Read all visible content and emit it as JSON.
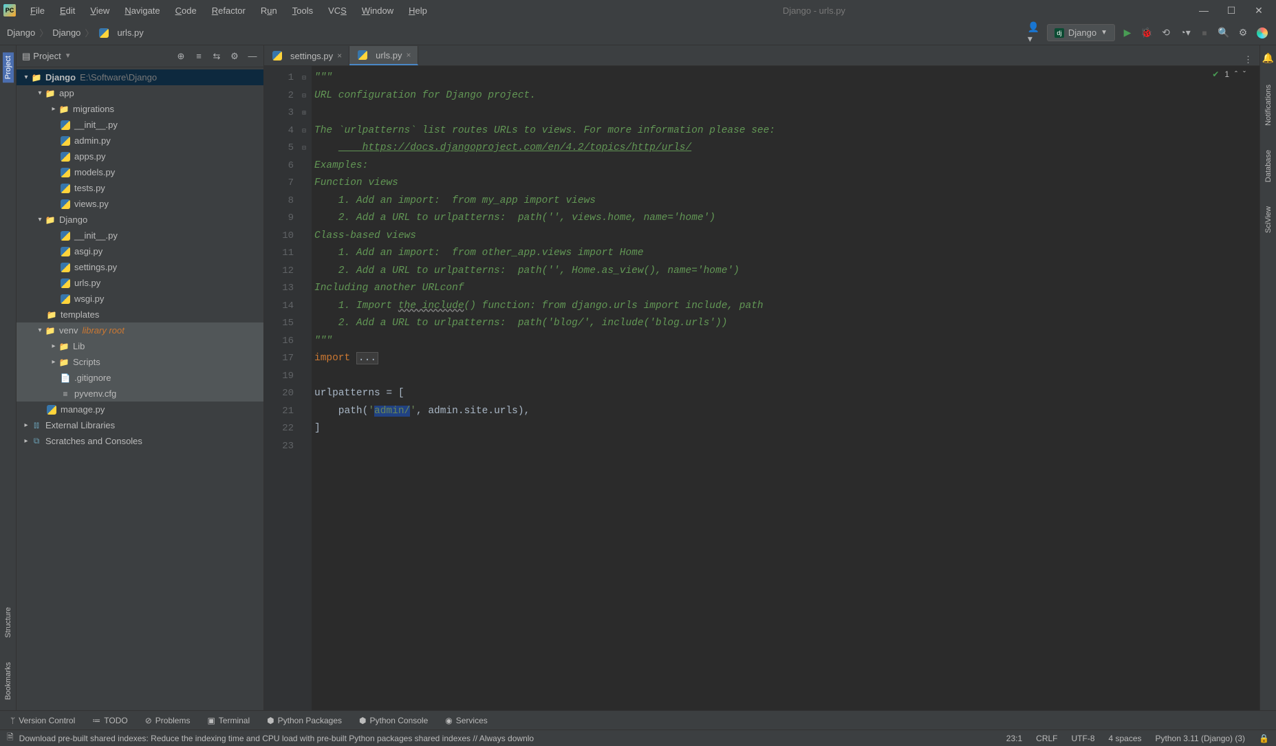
{
  "window": {
    "title": "Django - urls.py"
  },
  "menu": [
    "File",
    "Edit",
    "View",
    "Navigate",
    "Code",
    "Refactor",
    "Run",
    "Tools",
    "VCS",
    "Window",
    "Help"
  ],
  "breadcrumb": [
    "Django",
    "Django",
    "urls.py"
  ],
  "run_config": "Django",
  "project_header": "Project",
  "tree": {
    "root": {
      "name": "Django",
      "path": "E:\\Software\\Django"
    },
    "app": "app",
    "app_children": [
      "migrations",
      "__init__.py",
      "admin.py",
      "apps.py",
      "models.py",
      "tests.py",
      "views.py"
    ],
    "django_folder": "Django",
    "django_children": [
      "__init__.py",
      "asgi.py",
      "settings.py",
      "urls.py",
      "wsgi.py"
    ],
    "templates": "templates",
    "venv": "venv",
    "venv_note": "library root",
    "venv_children": [
      "Lib",
      "Scripts",
      ".gitignore",
      "pyvenv.cfg"
    ],
    "manage": "manage.py",
    "external": "External Libraries",
    "scratches": "Scratches and Consoles"
  },
  "tabs": [
    {
      "name": "settings.py",
      "active": false
    },
    {
      "name": "urls.py",
      "active": true
    }
  ],
  "inspection_count": "1",
  "code_lines": {
    "l1": "\"\"\"",
    "l2": "URL configuration for Django project.",
    "l3": "",
    "l4": "The `urlpatterns` list routes URLs to views. For more information please see:",
    "l5": "    https://docs.djangoproject.com/en/4.2/topics/http/urls/",
    "l6": "Examples:",
    "l7": "Function views",
    "l8": "    1. Add an import:  from my_app import views",
    "l9": "    2. Add a URL to urlpatterns:  path('', views.home, name='home')",
    "l10": "Class-based views",
    "l11": "    1. Add an import:  from other_app.views import Home",
    "l12": "    2. Add a URL to urlpatterns:  path('', Home.as_view(), name='home')",
    "l13": "Including another URLconf",
    "l14a": "    1. Import ",
    "l14b": "the include",
    "l14c": "() function: from django.urls import include, path",
    "l15": "    2. Add a URL to urlpatterns:  path('blog/', include('blog.urls'))",
    "l16": "\"\"\"",
    "l17a": "import ",
    "l17b": "...",
    "l19": "",
    "l20": "urlpatterns = [",
    "l21a": "    path(",
    "l21b": "'",
    "l21c": "admin/",
    "l21d": "'",
    "l21e": ", admin.site.urls),",
    "l22": "]",
    "l23": ""
  },
  "line_numbers": [
    "1",
    "2",
    "3",
    "4",
    "5",
    "6",
    "7",
    "8",
    "9",
    "10",
    "11",
    "12",
    "13",
    "14",
    "15",
    "16",
    "17",
    "19",
    "20",
    "21",
    "22",
    "23"
  ],
  "bottom_tools": [
    "Version Control",
    "TODO",
    "Problems",
    "Terminal",
    "Python Packages",
    "Python Console",
    "Services"
  ],
  "status": {
    "message": "Download pre-built shared indexes: Reduce the indexing time and CPU load with pre-built Python packages shared indexes // Always downlo",
    "cursor": "23:1",
    "line_sep": "CRLF",
    "encoding": "UTF-8",
    "indent": "4 spaces",
    "interpreter": "Python 3.11 (Django) (3)"
  },
  "right_tools": [
    "Notifications",
    "Database",
    "SciView"
  ]
}
